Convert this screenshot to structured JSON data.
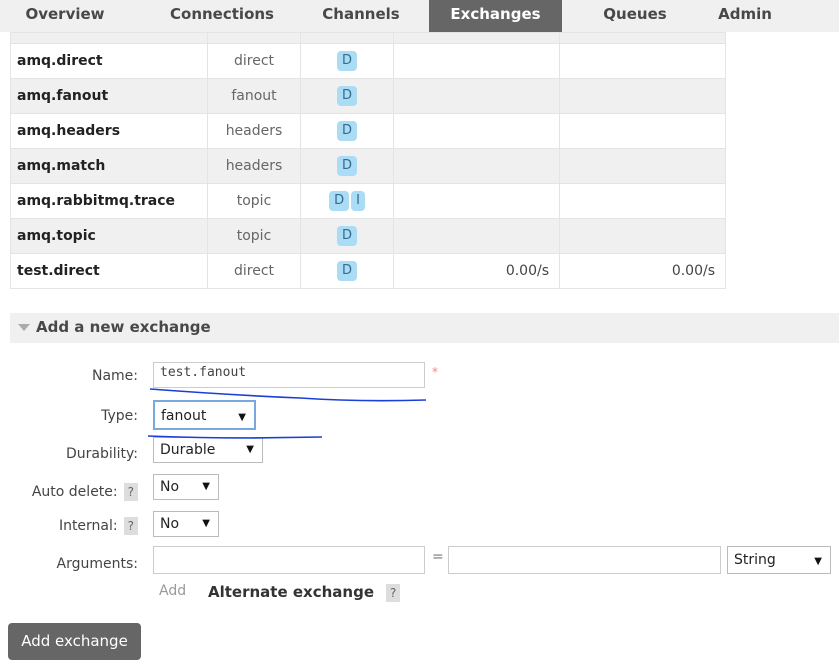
{
  "nav": {
    "tabs": [
      {
        "label": "Overview",
        "active": false
      },
      {
        "label": "Connections",
        "active": false
      },
      {
        "label": "Channels",
        "active": false
      },
      {
        "label": "Exchanges",
        "active": true
      },
      {
        "label": "Queues",
        "active": false
      },
      {
        "label": "Admin",
        "active": false
      }
    ]
  },
  "exchanges": [
    {
      "name": "amq.direct",
      "type": "direct",
      "features": [
        "D"
      ],
      "rate_in": "",
      "rate_out": ""
    },
    {
      "name": "amq.fanout",
      "type": "fanout",
      "features": [
        "D"
      ],
      "rate_in": "",
      "rate_out": ""
    },
    {
      "name": "amq.headers",
      "type": "headers",
      "features": [
        "D"
      ],
      "rate_in": "",
      "rate_out": ""
    },
    {
      "name": "amq.match",
      "type": "headers",
      "features": [
        "D"
      ],
      "rate_in": "",
      "rate_out": ""
    },
    {
      "name": "amq.rabbitmq.trace",
      "type": "topic",
      "features": [
        "D",
        "I"
      ],
      "rate_in": "",
      "rate_out": ""
    },
    {
      "name": "amq.topic",
      "type": "topic",
      "features": [
        "D"
      ],
      "rate_in": "",
      "rate_out": ""
    },
    {
      "name": "test.direct",
      "type": "direct",
      "features": [
        "D"
      ],
      "rate_in": "0.00/s",
      "rate_out": "0.00/s"
    }
  ],
  "add_exchange": {
    "section_title": "Add a new exchange",
    "name_label": "Name:",
    "name_value": "test.fanout",
    "required_mark": "*",
    "type_label": "Type:",
    "type_value": "fanout",
    "durability_label": "Durability:",
    "durability_value": "Durable",
    "auto_delete_label": "Auto delete:",
    "auto_delete_value": "No",
    "internal_label": "Internal:",
    "internal_value": "No",
    "arguments_label": "Arguments:",
    "arguments_key": "",
    "arguments_eq": "=",
    "arguments_value": "",
    "arguments_type": "String",
    "add_label": "Add",
    "alternate_exchange_label": "Alternate exchange",
    "help_mark": "?",
    "submit_label": "Add exchange"
  },
  "colors": {
    "active_tab": "#666666",
    "badge": "#aadcf5",
    "annotation_ink": "#1a3fd6"
  }
}
